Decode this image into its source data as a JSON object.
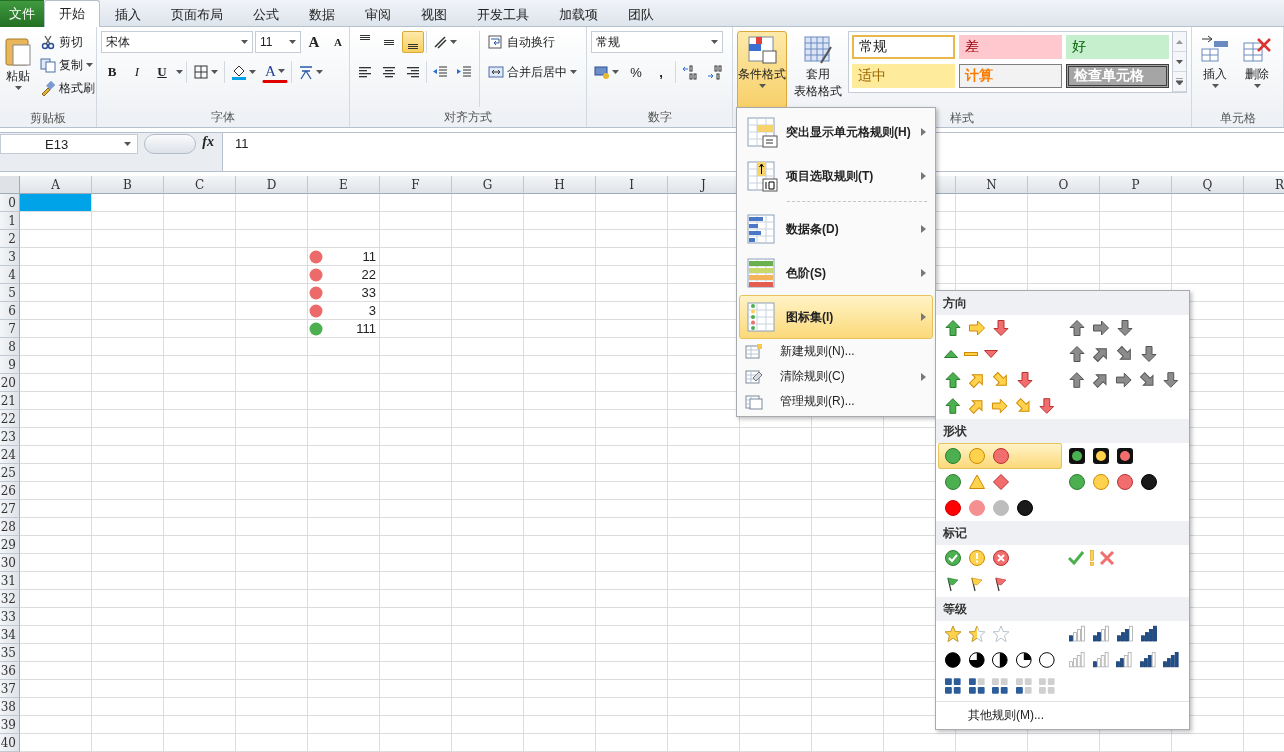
{
  "tabs": [
    {
      "label": "文件",
      "kind": "file",
      "selected": false
    },
    {
      "label": "开始",
      "kind": "tab",
      "selected": true
    },
    {
      "label": "插入",
      "kind": "tab",
      "selected": false
    },
    {
      "label": "页面布局",
      "kind": "tab",
      "selected": false
    },
    {
      "label": "公式",
      "kind": "tab",
      "selected": false
    },
    {
      "label": "数据",
      "kind": "tab",
      "selected": false
    },
    {
      "label": "审阅",
      "kind": "tab",
      "selected": false
    },
    {
      "label": "视图",
      "kind": "tab",
      "selected": false
    },
    {
      "label": "开发工具",
      "kind": "tab",
      "selected": false
    },
    {
      "label": "加载项",
      "kind": "tab",
      "selected": false
    },
    {
      "label": "团队",
      "kind": "tab",
      "selected": false
    }
  ],
  "clipboard": {
    "paste": "粘贴",
    "cut": "剪切",
    "copy": "复制",
    "format_painter": "格式刷",
    "label": "剪贴板"
  },
  "font": {
    "name": "宋体",
    "size": "11",
    "grow": "A",
    "shrink": "A",
    "bold": "B",
    "italic": "I",
    "underline": "U",
    "color_letter": "A",
    "label": "字体"
  },
  "alignment": {
    "vertical": [
      {
        "selected": false
      },
      {
        "selected": false
      },
      {
        "selected": true
      }
    ],
    "wrap": "自动换行",
    "merge": "合并后居中",
    "label": "对齐方式"
  },
  "number": {
    "format": "常规",
    "percent": "%",
    "comma": ",",
    "label": "数字"
  },
  "styles": {
    "conditional_format": {
      "label": "条件格式",
      "pressed": true
    },
    "table_format": [
      "套用",
      "表格格式"
    ],
    "cell_styles": [
      {
        "label": "常规",
        "kind": "normal"
      },
      {
        "label": "差",
        "kind": "bad"
      },
      {
        "label": "好",
        "kind": "good"
      },
      {
        "label": "适中",
        "kind": "neutral"
      },
      {
        "label": "计算",
        "kind": "calc"
      },
      {
        "label": "检查单元格",
        "kind": "check"
      }
    ],
    "label": "样式"
  },
  "cells": {
    "insert": "插入",
    "delete": "删除",
    "label": "单元格"
  },
  "formula_bar": {
    "name_box": "E13",
    "function_label": "fx",
    "value": "11"
  },
  "sheet": {
    "columns_left": [
      "A",
      "B",
      "C",
      "D",
      "E",
      "F",
      "G",
      "H",
      "I",
      "J"
    ],
    "columns_right": [
      "N",
      "O",
      "P",
      "Q",
      "R"
    ],
    "rows": [
      {
        "label": "0",
        "a_selected": true
      },
      {
        "label": "1",
        "a_selected": false
      },
      {
        "label": "2",
        "a_selected": false
      },
      {
        "label": "3",
        "a_selected": false,
        "e_value": "11",
        "color": "#ec6a6a"
      },
      {
        "label": "4",
        "a_selected": false,
        "e_value": "22",
        "color": "#ec6a6a"
      },
      {
        "label": "5",
        "a_selected": false,
        "e_value": "33",
        "color": "#ec6a6a"
      },
      {
        "label": "6",
        "a_selected": false,
        "e_value": "3",
        "color": "#ec6a6a"
      },
      {
        "label": "7",
        "a_selected": false,
        "e_value": "111",
        "color": "#4caf50"
      },
      {
        "label": "8",
        "a_selected": false
      },
      {
        "label": "9",
        "a_selected": false
      },
      {
        "label": "20",
        "a_selected": false
      },
      {
        "label": "21",
        "a_selected": false
      },
      {
        "label": "22",
        "a_selected": false
      },
      {
        "label": "23",
        "a_selected": false
      },
      {
        "label": "24",
        "a_selected": false
      },
      {
        "label": "25",
        "a_selected": false
      },
      {
        "label": "26",
        "a_selected": false
      },
      {
        "label": "27",
        "a_selected": false
      },
      {
        "label": "28",
        "a_selected": false
      },
      {
        "label": "29",
        "a_selected": false
      },
      {
        "label": "30",
        "a_selected": false
      },
      {
        "label": "31",
        "a_selected": false
      },
      {
        "label": "32",
        "a_selected": false
      },
      {
        "label": "33",
        "a_selected": false
      },
      {
        "label": "34",
        "a_selected": false
      },
      {
        "label": "35",
        "a_selected": false
      },
      {
        "label": "36",
        "a_selected": false
      },
      {
        "label": "37",
        "a_selected": false
      },
      {
        "label": "38",
        "a_selected": false
      },
      {
        "label": "39",
        "a_selected": false
      },
      {
        "label": "40",
        "a_selected": false
      }
    ]
  },
  "menu": {
    "items": [
      {
        "kind": "large",
        "label": "突出显示单元格规则(H)",
        "submenu": true,
        "selected": false
      },
      {
        "kind": "large",
        "label": "项目选取规则(T)",
        "submenu": true,
        "selected": false
      },
      {
        "kind": "separator"
      },
      {
        "kind": "large",
        "label": "数据条(D)",
        "submenu": true,
        "selected": false
      },
      {
        "kind": "large",
        "label": "色阶(S)",
        "submenu": true,
        "selected": false
      },
      {
        "kind": "large",
        "label": "图标集(I)",
        "submenu": true,
        "selected": true
      },
      {
        "kind": "small",
        "label": "新建规则(N)...",
        "submenu": false,
        "selected": false
      },
      {
        "kind": "small",
        "label": "清除规则(C)",
        "submenu": true,
        "selected": false
      },
      {
        "kind": "small",
        "label": "管理规则(R)...",
        "submenu": false,
        "selected": false
      }
    ]
  },
  "icon_sets_menu": {
    "sections": [
      {
        "title": "方向",
        "sets": [
          {
            "selected": false
          },
          {
            "selected": false
          },
          {
            "selected": false
          },
          {
            "selected": false
          },
          {
            "selected": false
          },
          {
            "selected": false
          },
          {
            "selected": false
          }
        ]
      },
      {
        "title": "形状",
        "sets": [
          {
            "selected": true
          },
          {
            "selected": false
          },
          {
            "selected": false
          },
          {
            "selected": false
          },
          {
            "selected": false
          }
        ]
      },
      {
        "title": "标记",
        "sets": [
          {
            "selected": false
          },
          {
            "selected": false
          },
          {
            "selected": false
          }
        ]
      },
      {
        "title": "等级",
        "sets": [
          {
            "selected": false
          },
          {
            "selected": false
          },
          {
            "selected": false
          },
          {
            "selected": false
          },
          {
            "selected": false
          }
        ]
      }
    ],
    "more": "其他规则(M)..."
  }
}
